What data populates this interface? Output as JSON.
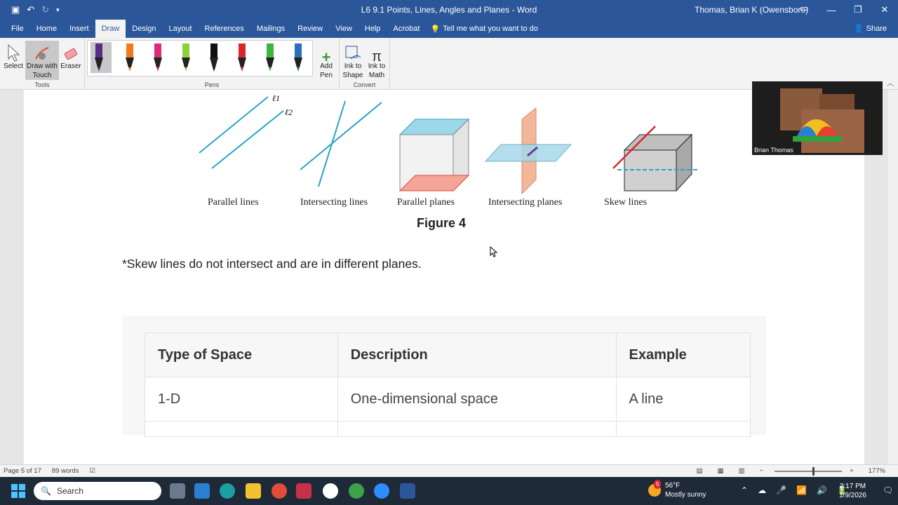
{
  "window": {
    "title": "L6 9.1 Points, Lines, Angles and Planes  -  Word",
    "user": "Thomas, Brian K (Owensboro)"
  },
  "tabs": [
    "File",
    "Home",
    "Insert",
    "Draw",
    "Design",
    "Layout",
    "References",
    "Mailings",
    "Review",
    "View",
    "Help",
    "Acrobat"
  ],
  "tell_me": "Tell me what you want to do",
  "share": "Share",
  "ribbon": {
    "tools": {
      "label": "Tools",
      "select": "Select",
      "draw_touch": "Draw with Touch",
      "eraser": "Eraser"
    },
    "pens": {
      "label": "Pens",
      "add_pen": "Add Pen"
    },
    "convert": {
      "label": "Convert",
      "ink_shape": "Ink to Shape",
      "ink_math": "Ink to Math"
    }
  },
  "pens": [
    {
      "color": "#5b2a86"
    },
    {
      "color": "#f07b1c"
    },
    {
      "color": "#e0287c"
    },
    {
      "color": "#8cd13a"
    },
    {
      "color": "#111111"
    },
    {
      "color": "#d9262e"
    },
    {
      "color": "#3cb63c"
    },
    {
      "color": "#2a6fb8"
    }
  ],
  "figure": {
    "labels": [
      "Parallel lines",
      "Intersecting lines",
      "Parallel planes",
      "Intersecting planes",
      "Skew lines"
    ],
    "line_labels": [
      "ℓ1",
      "ℓ2"
    ],
    "title": "Figure 4"
  },
  "note": "*Skew lines do not intersect and are in different planes.",
  "table": {
    "headers": [
      "Type of Space",
      "Description",
      "Example"
    ],
    "rows": [
      [
        "1-D",
        "One-dimensional space",
        "A line"
      ]
    ]
  },
  "video": {
    "name": "Brian Thomas"
  },
  "status": {
    "page": "Page 5 of 17",
    "words": "89 words",
    "zoom": "177%"
  },
  "taskbar": {
    "search": "Search",
    "weather_temp": "56°F",
    "weather_desc": "Mostly sunny",
    "weather_badge": "5",
    "time": "2:17 PM",
    "date": "1/9/2026"
  }
}
